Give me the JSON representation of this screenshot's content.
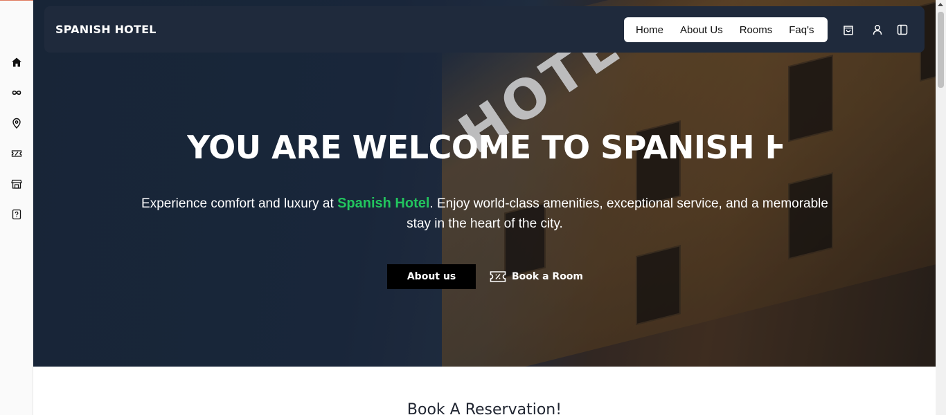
{
  "sidebar": {
    "items": [
      {
        "icon": "home-icon"
      },
      {
        "icon": "infinity-icon"
      },
      {
        "icon": "map-pin-icon"
      },
      {
        "icon": "ticket-icon"
      },
      {
        "icon": "store-icon"
      },
      {
        "icon": "help-file-icon"
      }
    ]
  },
  "navbar": {
    "brand": "SPANISH HOTEL",
    "links": [
      "Home",
      "About Us",
      "Rooms",
      "Faq's"
    ],
    "icons": [
      "shopping-bag-icon",
      "user-icon",
      "panel-icon"
    ]
  },
  "hero": {
    "title": "YOU ARE WELCOME TO SPANISH HOT",
    "subtitle_before": "Experience comfort and luxury at ",
    "subtitle_accent": "Spanish Hotel",
    "subtitle_after": ". Enjoy world-class amenities, exceptional service, and a memorable stay in the heart of the city.",
    "background_sign": "HOTEL",
    "about_button": "About us",
    "book_button": "Book a Room"
  },
  "reservation": {
    "title": "Book A Reservation!"
  },
  "colors": {
    "accent": "#22c55e",
    "navbar_bg": "#1f2a3c",
    "button_bg": "#000000"
  }
}
